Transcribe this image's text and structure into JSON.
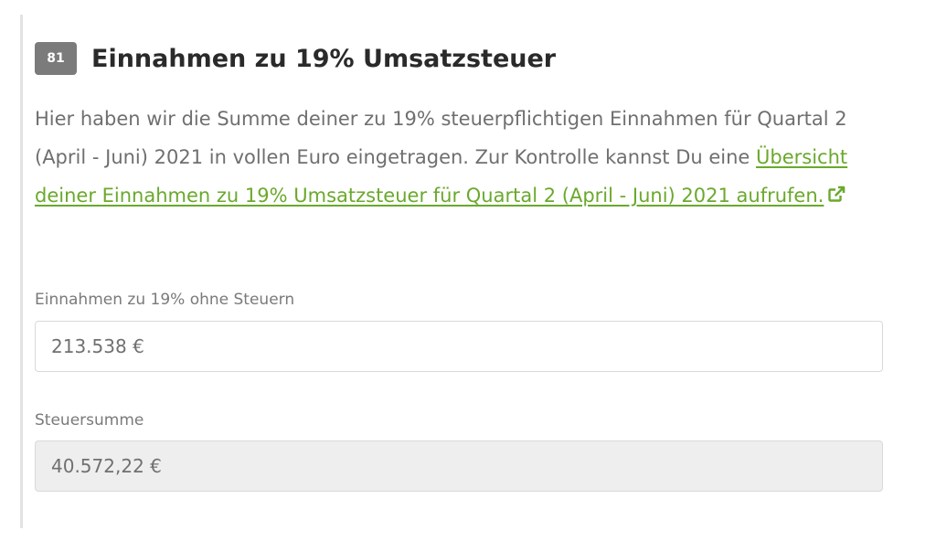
{
  "section": {
    "number": "81",
    "title": "Einnahmen zu 19% Umsatzsteuer",
    "description_text": "Hier haben wir die Summe deiner zu 19% steuerpflichtigen Einnahmen für Quartal 2 (April - Juni) 2021 in vollen Euro eingetragen. Zur Kontrolle kannst Du eine ",
    "link_text": "Übersicht deiner Einnahmen zu 19% Umsatzsteuer für Quartal 2 (April - Juni) 2021 aufrufen.",
    "link_icon": "external-link-icon",
    "link_color": "#6aa92c"
  },
  "fields": {
    "net_income": {
      "label": "Einnahmen zu 19% ohne Steuern",
      "value": "213.538 €"
    },
    "tax_total": {
      "label": "Steuersumme",
      "value": "40.572,22 €"
    }
  }
}
